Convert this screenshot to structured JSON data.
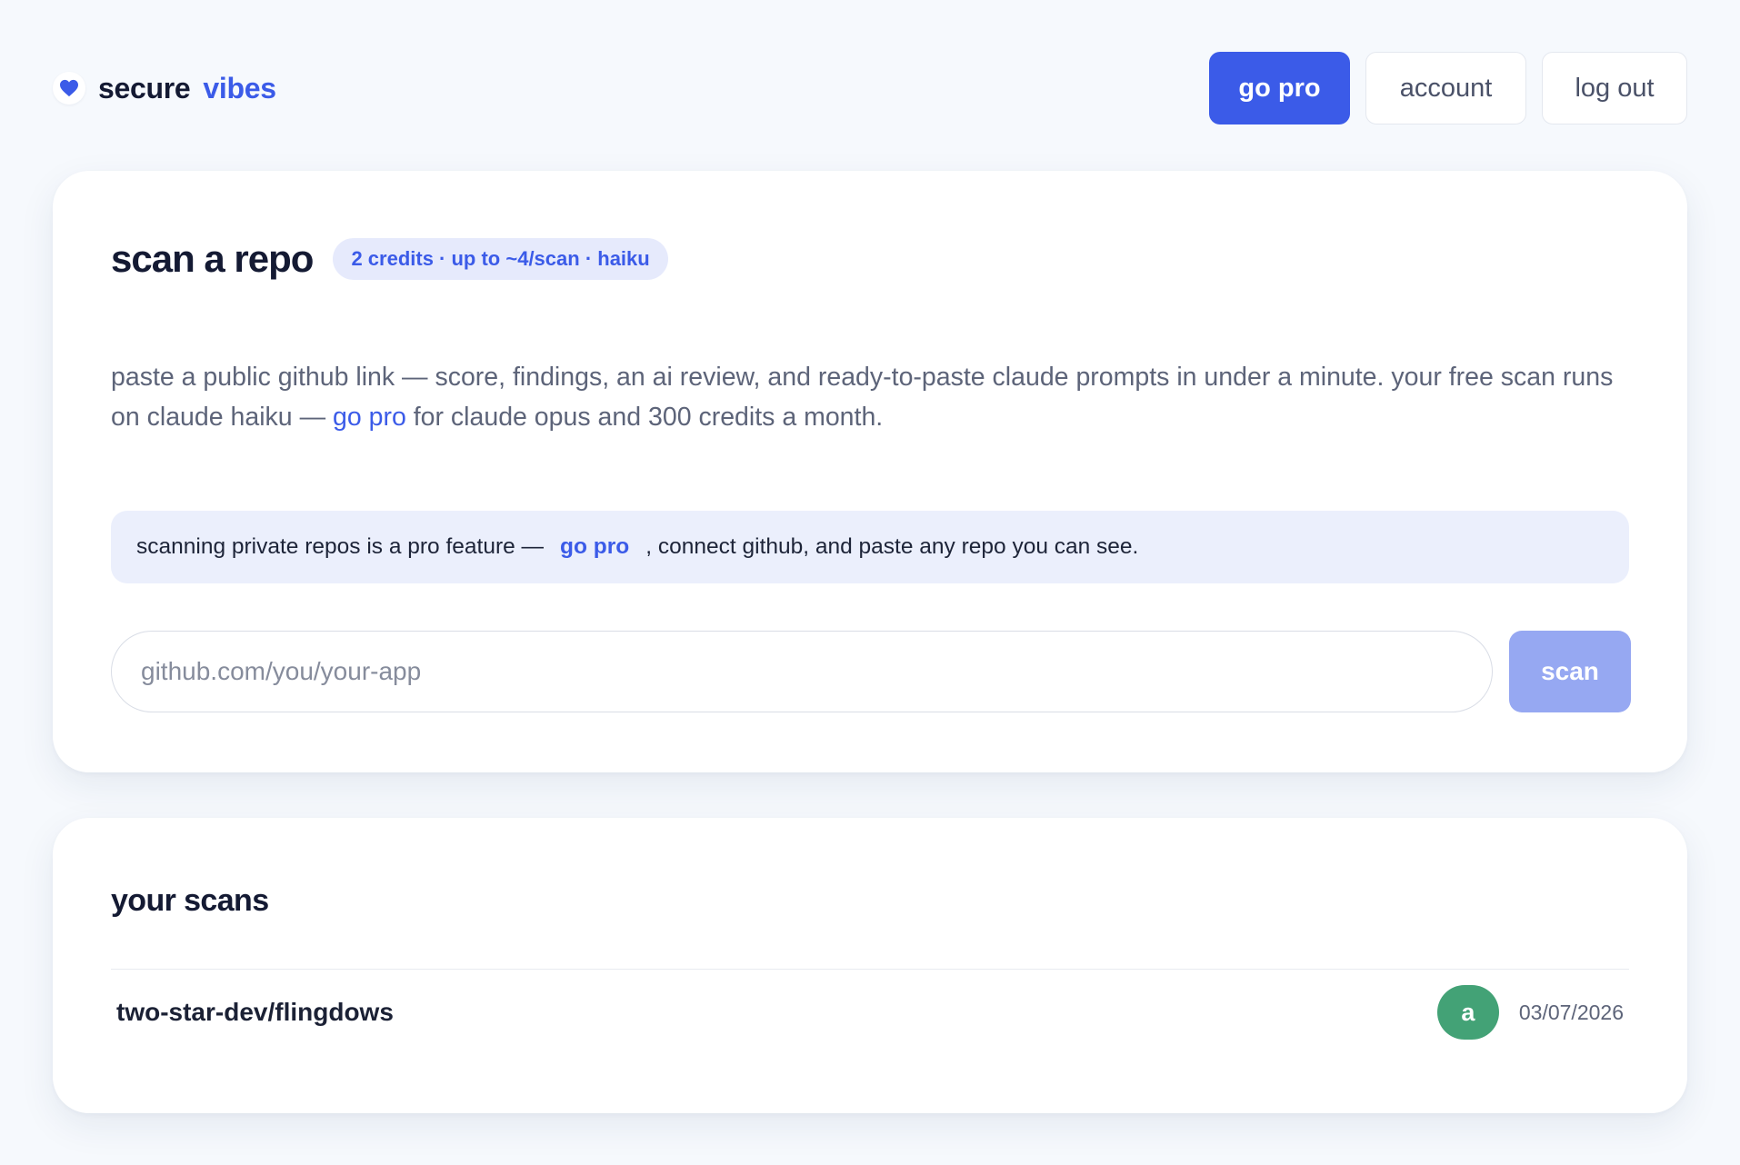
{
  "brand": {
    "icon": "heart-icon",
    "word1": "secure",
    "word2": "vibes",
    "accent_color": "#3b5be8"
  },
  "nav": {
    "go_pro": "go pro",
    "account": "account",
    "log_out": "log out"
  },
  "scan_card": {
    "title": "scan a repo",
    "badge": "2 credits · up to ~4/scan · haiku",
    "description_part1": "paste a public github link — score, findings, an ai review, and ready-to-paste claude prompts in under a minute. your free scan runs on claude haiku — ",
    "description_link": "go pro",
    "description_part2": " for claude opus and 300 credits a month.",
    "notice_part1": "scanning private repos is a pro feature —",
    "notice_link": "go pro",
    "notice_part2": ", connect github, and paste any repo you can see.",
    "input_placeholder": "github.com/you/your-app",
    "input_value": "",
    "scan_button": "scan"
  },
  "scans_card": {
    "title": "your scans",
    "rows": [
      {
        "repo": "two-star-dev/flingdows",
        "grade": "a",
        "grade_color": "#43a276",
        "date": "03/07/2026"
      }
    ]
  }
}
